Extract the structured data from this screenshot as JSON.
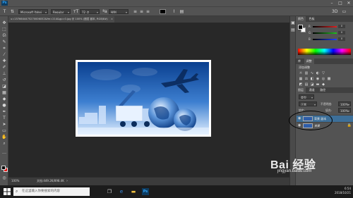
{
  "app": {
    "logo": "Ps"
  },
  "options": {
    "font_family": "Microsoft Yahei",
    "font_style": "Regular",
    "font_size": "72 点",
    "antialias": "锐利",
    "text_color": "#000000"
  },
  "document": {
    "tab_title": "u=1576644475270006052&fm=214&gp=0.jpg @ 100% (图层 副本, RGB/8#)"
  },
  "status": {
    "zoom": "100%",
    "doc_size": "文档:449.2K/898.4K"
  },
  "color_panel": {
    "tabs": [
      "颜色",
      "色板"
    ],
    "sliders": [
      {
        "label": "R",
        "value": "0",
        "color": "#e02020"
      },
      {
        "label": "G",
        "value": "0",
        "color": "#20c020"
      },
      {
        "label": "B",
        "value": "0",
        "color": "#2040ff"
      }
    ]
  },
  "adjust_panel": {
    "tabs": [
      "库",
      "调整"
    ],
    "label": "添加调整"
  },
  "layers_panel": {
    "tabs": [
      "图层",
      "通道",
      "路径"
    ],
    "kind_label": "类型",
    "blend_mode": "正常",
    "opacity_label": "不透明度:",
    "opacity": "100%",
    "lock_label": "锁定:",
    "fill_label": "填充:",
    "fill": "100%",
    "layers": [
      {
        "name": "背景 副本",
        "selected": true
      },
      {
        "name": "背景",
        "selected": false
      }
    ]
  },
  "taskbar": {
    "search_placeholder": "在这里输入你要搜索的内容",
    "time": "6:54",
    "date": "2018/10/21"
  },
  "watermark": {
    "text": "Bai 经验",
    "sub": "jingyan.baidu.com"
  },
  "colors": {
    "accent": "#31a8ff",
    "selection": "#3d6f99",
    "panel": "#535353",
    "canvas": "#282828"
  }
}
